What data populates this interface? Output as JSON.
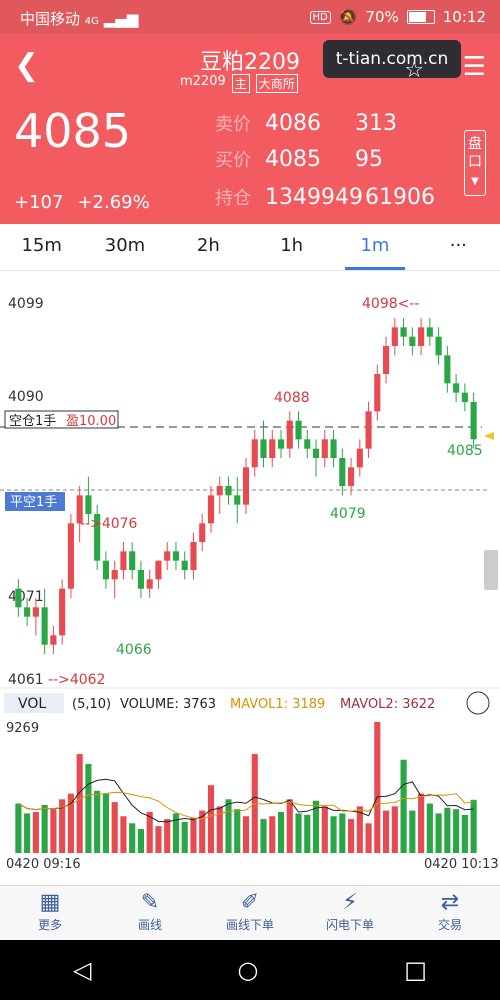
{
  "status": {
    "carrier": "中国移动",
    "net": "4G",
    "hd": "HD",
    "battery": "70%",
    "time": "10:12"
  },
  "header": {
    "title": "豆粕2209",
    "code": "m2209",
    "tag1": "主",
    "tag2": "大商所",
    "watermark": "t-tian.com.cn",
    "last_price": "4085",
    "change": "+107",
    "change_pct": "+2.69%",
    "ask_label": "卖价",
    "ask_price": "4086",
    "ask_vol": "313",
    "bid_label": "买价",
    "bid_price": "4085",
    "bid_vol": "95",
    "oi_label": "持仓",
    "oi_value": "1349949",
    "oi_change": "61906",
    "pan_label": "盘口"
  },
  "tabs": [
    "15m",
    "30m",
    "2h",
    "1h",
    "1m",
    "···"
  ],
  "active_tab": 4,
  "chart_data": {
    "type": "candlestick",
    "y_labels": [
      "4099",
      "4090",
      "4071",
      "4061"
    ],
    "yrange": [
      4059,
      4101
    ],
    "annotations": {
      "high": "4098<--",
      "low": "-->4062",
      "low2": "-->4076",
      "p4088": "4088",
      "p4079": "4079",
      "p4066": "4066",
      "cur": "4085",
      "short_pos": "空仓1手",
      "pnl": "盈10.00",
      "close_short": "平空1手"
    },
    "candles": [
      [
        4069,
        4070,
        4066,
        4067
      ],
      [
        4067,
        4068,
        4065,
        4066
      ],
      [
        4066,
        4068,
        4064,
        4067
      ],
      [
        4067,
        4069,
        4062,
        4063
      ],
      [
        4063,
        4065,
        4062,
        4064
      ],
      [
        4064,
        4070,
        4063,
        4069
      ],
      [
        4069,
        4077,
        4068,
        4076
      ],
      [
        4076,
        4080,
        4074,
        4079
      ],
      [
        4079,
        4081,
        4076,
        4077
      ],
      [
        4077,
        4078,
        4071,
        4072
      ],
      [
        4072,
        4073,
        4069,
        4070
      ],
      [
        4070,
        4072,
        4068,
        4071
      ],
      [
        4071,
        4074,
        4070,
        4073
      ],
      [
        4073,
        4074,
        4070,
        4071
      ],
      [
        4071,
        4072,
        4068,
        4069
      ],
      [
        4069,
        4071,
        4068,
        4070
      ],
      [
        4070,
        4072,
        4069,
        4072
      ],
      [
        4072,
        4074,
        4071,
        4073
      ],
      [
        4073,
        4074,
        4071,
        4072
      ],
      [
        4072,
        4073,
        4070,
        4071
      ],
      [
        4071,
        4075,
        4070,
        4074
      ],
      [
        4074,
        4077,
        4073,
        4076
      ],
      [
        4076,
        4080,
        4075,
        4079
      ],
      [
        4079,
        4081,
        4077,
        4080
      ],
      [
        4080,
        4081,
        4078,
        4079
      ],
      [
        4079,
        4081,
        4076,
        4078
      ],
      [
        4078,
        4083,
        4077,
        4082
      ],
      [
        4082,
        4086,
        4081,
        4085
      ],
      [
        4085,
        4087,
        4082,
        4083
      ],
      [
        4083,
        4086,
        4082,
        4085
      ],
      [
        4085,
        4086,
        4083,
        4084
      ],
      [
        4084,
        4088,
        4083,
        4087
      ],
      [
        4087,
        4088,
        4084,
        4085
      ],
      [
        4085,
        4086,
        4083,
        4084
      ],
      [
        4084,
        4085,
        4081,
        4083
      ],
      [
        4083,
        4086,
        4082,
        4085
      ],
      [
        4085,
        4086,
        4082,
        4083
      ],
      [
        4083,
        4084,
        4079,
        4080
      ],
      [
        4080,
        4083,
        4079,
        4082
      ],
      [
        4082,
        4085,
        4081,
        4084
      ],
      [
        4084,
        4089,
        4083,
        4088
      ],
      [
        4088,
        4093,
        4087,
        4092
      ],
      [
        4092,
        4096,
        4091,
        4095
      ],
      [
        4095,
        4098,
        4094,
        4097
      ],
      [
        4097,
        4098,
        4095,
        4096
      ],
      [
        4096,
        4097,
        4094,
        4095
      ],
      [
        4095,
        4098,
        4094,
        4097
      ],
      [
        4097,
        4098,
        4095,
        4096
      ],
      [
        4096,
        4097,
        4093,
        4094
      ],
      [
        4094,
        4095,
        4090,
        4091
      ],
      [
        4091,
        4092,
        4089,
        4090
      ],
      [
        4090,
        4091,
        4088,
        4089
      ],
      [
        4089,
        4090,
        4084,
        4085
      ]
    ],
    "volume_label": "VOL",
    "volume_param": "(5,10)",
    "volume": "VOLUME: 3763",
    "mavol1": "MAVOL1: 3189",
    "mavol2": "MAVOL2: 3622",
    "vol_max_label": "9269",
    "vols": [
      3500,
      2800,
      2900,
      3400,
      3100,
      3800,
      4200,
      7000,
      6300,
      4400,
      4200,
      3600,
      2600,
      2100,
      1700,
      2900,
      1900,
      2400,
      2800,
      2200,
      2500,
      3000,
      4800,
      3300,
      3800,
      3100,
      2600,
      7000,
      2400,
      2600,
      2900,
      3800,
      2800,
      2700,
      3700,
      3300,
      2600,
      2800,
      2400,
      3300,
      2100,
      9269,
      3000,
      3300,
      6600,
      3000,
      4200,
      3500,
      2800,
      3200,
      3100,
      2700,
      3763
    ],
    "x_start": "0420 09:16",
    "x_end": "0420 10:13"
  },
  "bottom_nav": [
    {
      "label": "更多",
      "icon": "grid-icon"
    },
    {
      "label": "画线",
      "icon": "pen-icon"
    },
    {
      "label": "画线下单",
      "icon": "draw-order-icon"
    },
    {
      "label": "闪电下单",
      "icon": "lightning-icon"
    },
    {
      "label": "交易",
      "icon": "trade-icon"
    }
  ]
}
